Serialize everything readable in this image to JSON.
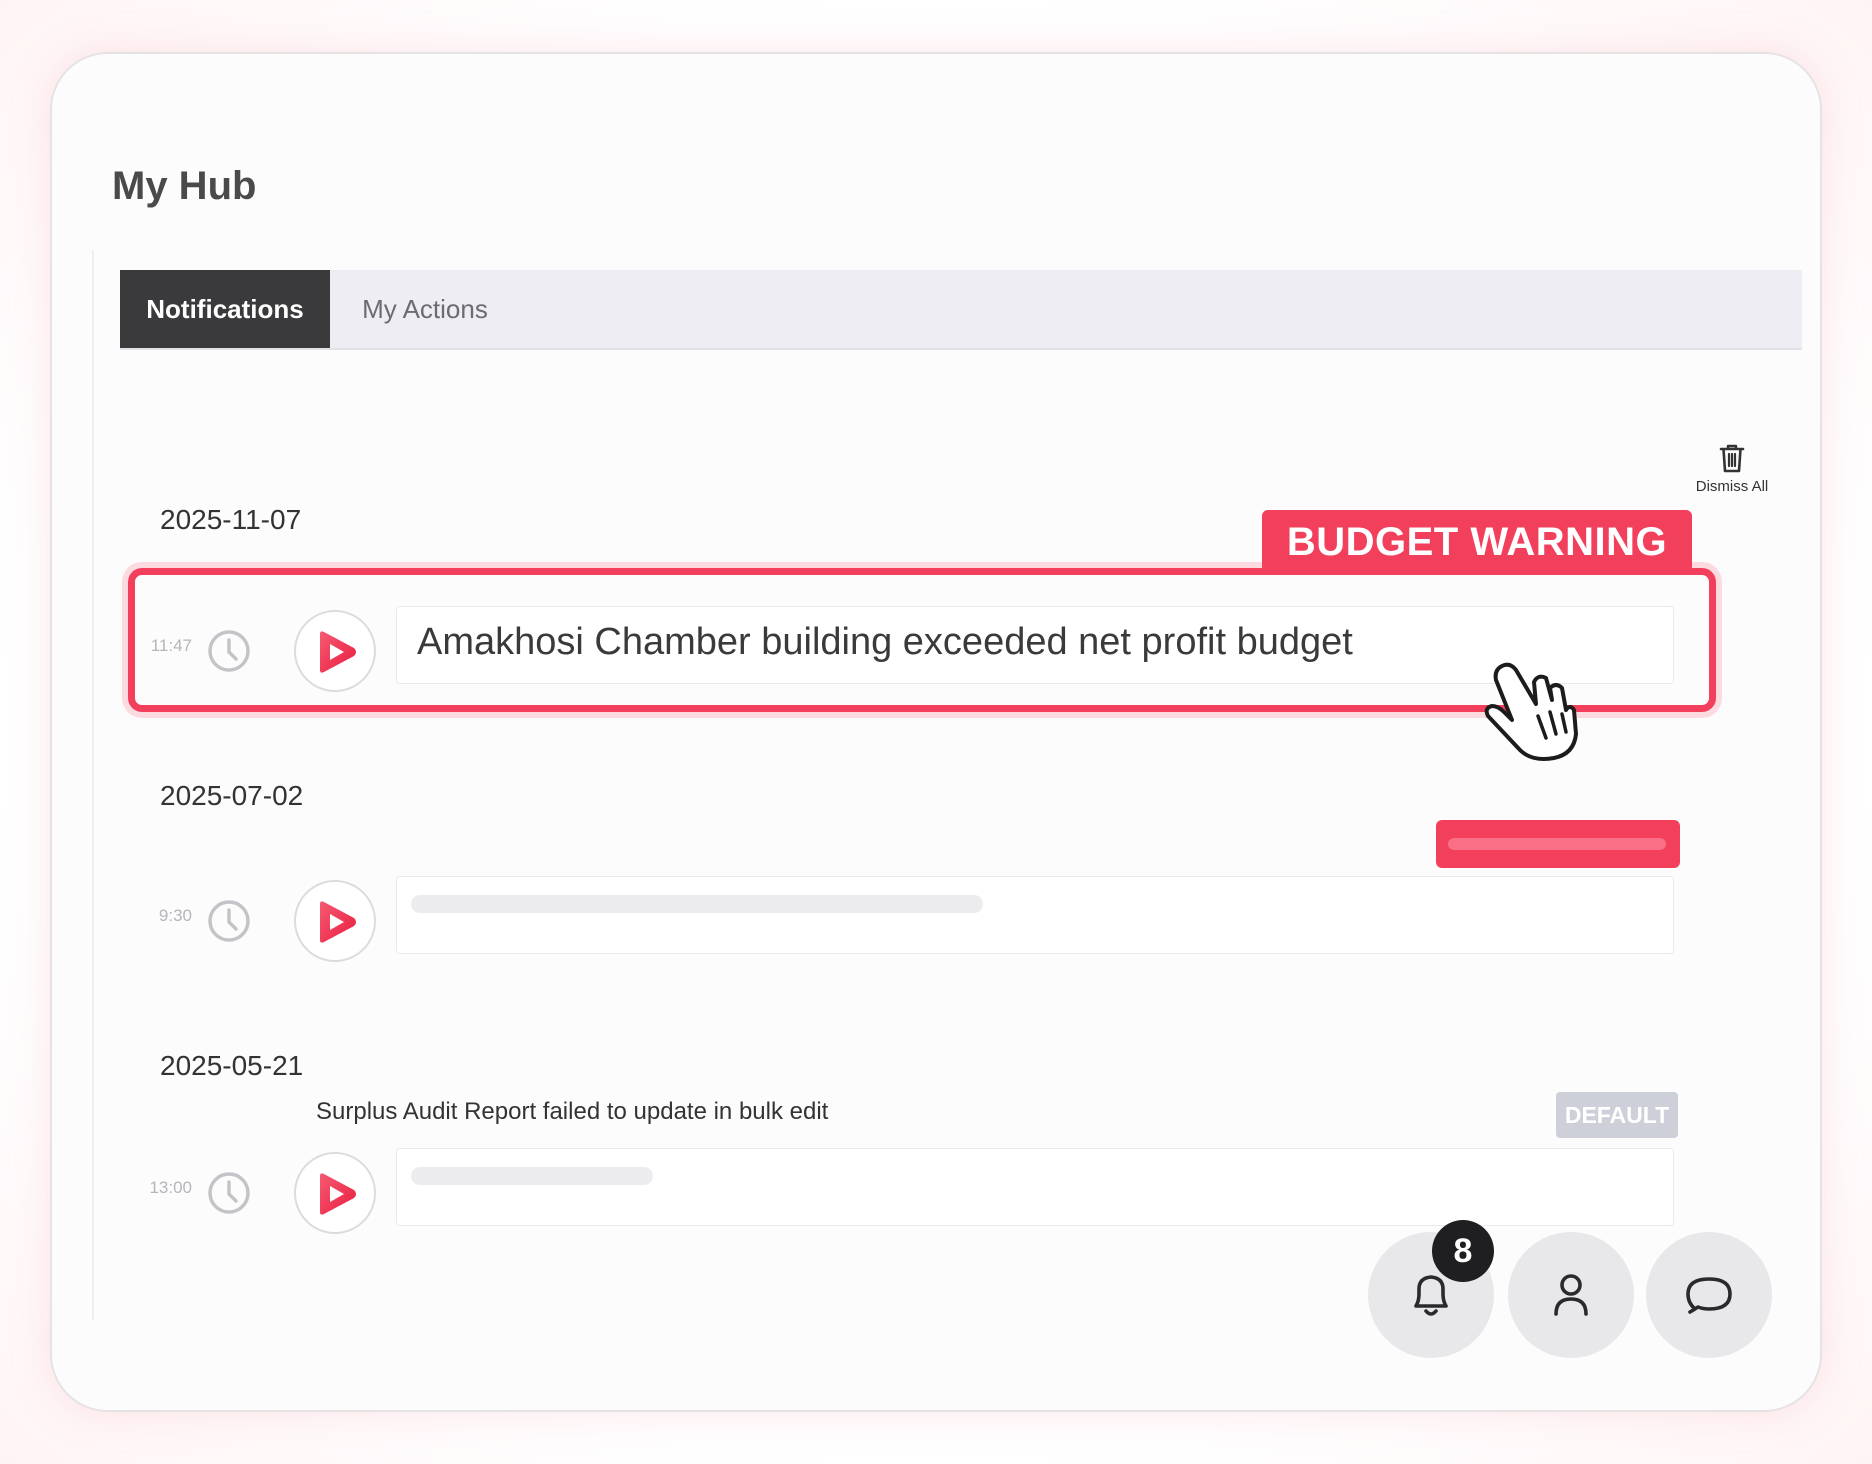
{
  "page": {
    "title": "My Hub"
  },
  "tabs": [
    {
      "label": "Notifications",
      "active": true
    },
    {
      "label": "My Actions",
      "active": false
    }
  ],
  "dismiss_all": {
    "label": "Dismiss All",
    "icon": "trash-icon"
  },
  "groups": [
    {
      "date": "2025-11-07",
      "items": [
        {
          "time": "11:47",
          "tag": "BUDGET WARNING",
          "message": "Amakhosi Chamber building exceeded net profit budget",
          "highlighted": true
        }
      ]
    },
    {
      "date": "2025-07-02",
      "items": [
        {
          "time": "9:30",
          "message": "",
          "tag_color": "#f2405c"
        }
      ]
    },
    {
      "date": "2025-05-21",
      "items": [
        {
          "time": "13:00",
          "caption": "Surplus Audit Report failed to update in bulk edit",
          "badge": "DEFAULT",
          "message": ""
        }
      ]
    }
  ],
  "fabs": [
    {
      "icon": "bell-icon",
      "badge_count": "8"
    },
    {
      "icon": "user-icon"
    },
    {
      "icon": "chat-icon"
    }
  ],
  "colors": {
    "accent": "#f2405c",
    "tab_active_bg": "#3a3a3c",
    "badge_default": "#cdd0d8"
  }
}
